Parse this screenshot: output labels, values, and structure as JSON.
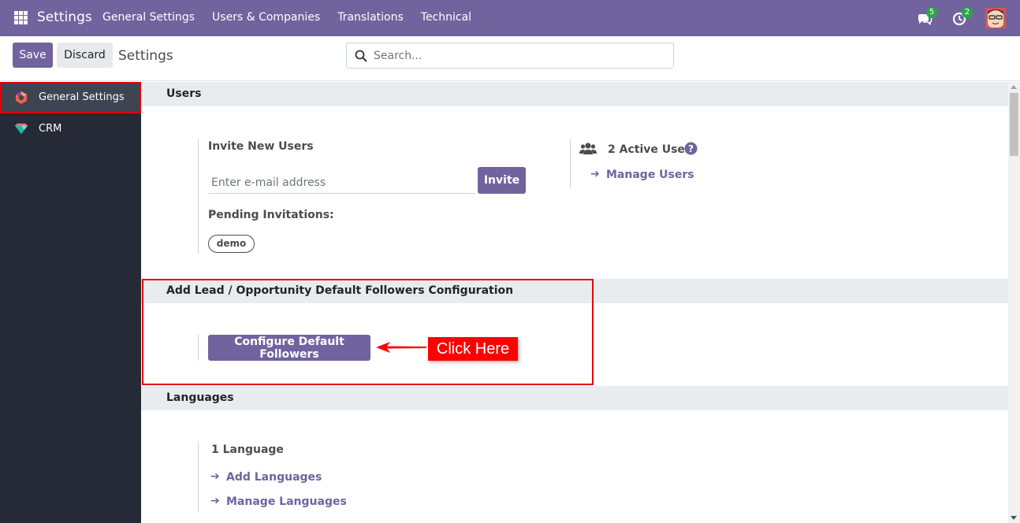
{
  "navbar": {
    "app_name": "Settings",
    "menu": [
      "General Settings",
      "Users & Companies",
      "Translations",
      "Technical"
    ],
    "chat_count": "5",
    "activity_count": "2"
  },
  "control_panel": {
    "save_label": "Save",
    "discard_label": "Discard",
    "title": "Settings",
    "search_placeholder": "Search..."
  },
  "sidebar": {
    "items": [
      {
        "label": "General Settings",
        "icon": "settings-hexagon-icon",
        "active": true
      },
      {
        "label": "CRM",
        "icon": "crm-gem-icon",
        "active": false
      }
    ]
  },
  "users_section": {
    "title": "Users",
    "invite_label": "Invite New Users",
    "email_placeholder": "Enter e-mail address",
    "invite_button": "Invite",
    "pending_label": "Pending Invitations:",
    "pending_tags": [
      "demo"
    ],
    "active_users": "2 Active User",
    "manage_users": "Manage Users"
  },
  "followers_section": {
    "title": "Add Lead / Opportunity Default Followers Configuration",
    "configure_button": "Configure Default Followers",
    "callout": "Click Here"
  },
  "languages_section": {
    "title": "Languages",
    "count": "1 Language",
    "add_languages": "Add Languages",
    "manage_languages": "Manage Languages"
  },
  "colors": {
    "brand": "#71639e",
    "sidebar_bg": "#262a36",
    "highlight": "#e30000"
  }
}
